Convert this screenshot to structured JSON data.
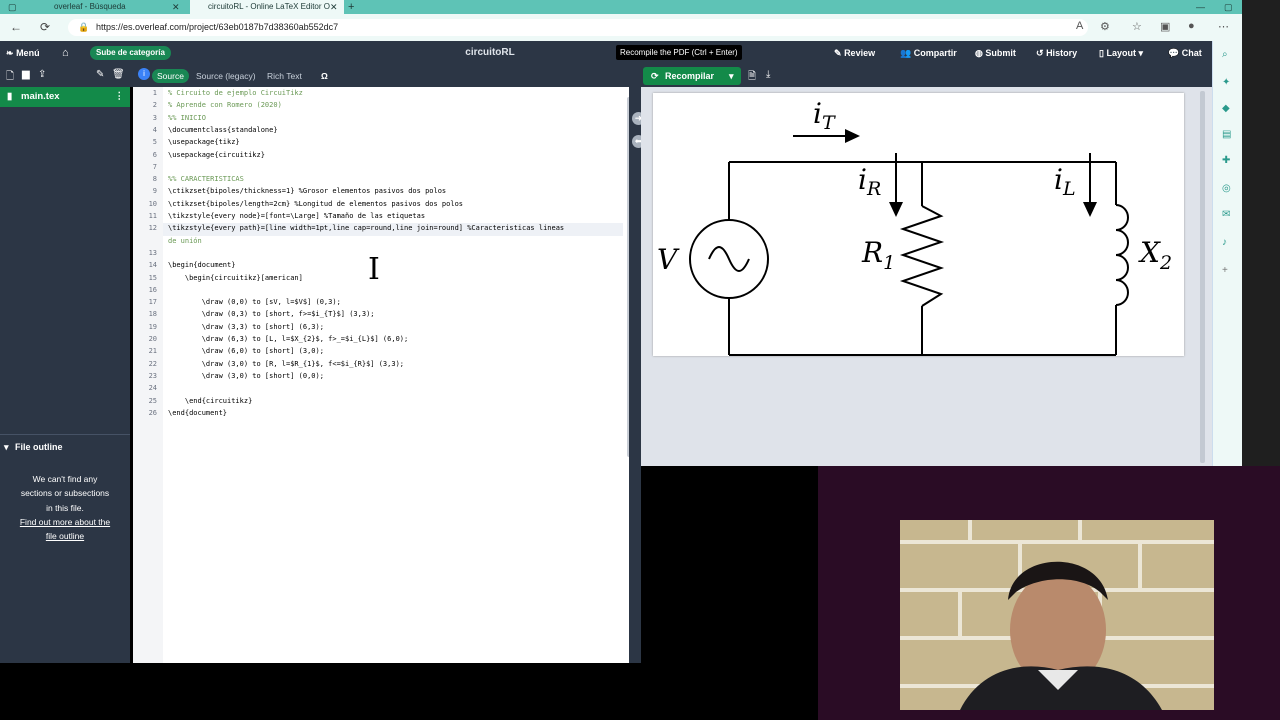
{
  "browser": {
    "tabs": [
      {
        "label": "overleaf - Búsqueda"
      },
      {
        "label": "circuitoRL - Online LaTeX Editor O"
      }
    ],
    "url": "https://es.overleaf.com/project/63eb0187b7d38360ab552dc7"
  },
  "toolbar": {
    "menu": "Menú",
    "category_badge": "Sube de categoría",
    "project_title": "circuitoRL",
    "tooltip": "Recompile the PDF (Ctrl + Enter)",
    "review": "Review",
    "share": "Compartir",
    "submit": "Submit",
    "history": "History",
    "layout": "Layout",
    "chat": "Chat"
  },
  "editor_tabs": {
    "source": "Source",
    "source_legacy": "Source (legacy)",
    "rich_text": "Rich Text",
    "symbol": "Ω"
  },
  "recompile": "Recompilar",
  "file_tree": {
    "main_file": "main.tex"
  },
  "outline": {
    "header": "File outline",
    "line1": "We can't find any",
    "line2": "sections or subsections",
    "line3": "in this file.",
    "link1": "Find out more about the",
    "link2": "file outline"
  },
  "code": [
    {
      "n": "1",
      "text": "% Circuito de ejemplo CircuiTikz",
      "kind": "cmt"
    },
    {
      "n": "2",
      "text": "% Aprende con Romero (2020)",
      "kind": "cmt"
    },
    {
      "n": "3",
      "text": "%% INICIO",
      "kind": "cmt"
    },
    {
      "n": "4",
      "text": "\\documentclass{standalone}",
      "kind": "code"
    },
    {
      "n": "5",
      "text": "\\usepackage{tikz}",
      "kind": "code"
    },
    {
      "n": "6",
      "text": "\\usepackage{circuitikz}",
      "kind": "code"
    },
    {
      "n": "7",
      "text": "",
      "kind": "code"
    },
    {
      "n": "8",
      "text": "%% CARACTERISTICAS",
      "kind": "cmt"
    },
    {
      "n": "9",
      "text": "\\ctikzset{bipoles/thickness=1} %Grosor elementos pasivos dos polos",
      "kind": "code"
    },
    {
      "n": "10",
      "text": "\\ctikzset{bipoles/length=2cm} %Longitud de elementos pasivos dos polos",
      "kind": "code"
    },
    {
      "n": "11",
      "text": "\\tikzstyle{every node}=[font=\\Large] %Tamaño de las etiquetas",
      "kind": "code"
    },
    {
      "n": "12",
      "text": "\\tikzstyle{every path}=[line width=1pt,line cap=round,line join=round] %Caracteristicas lineas",
      "kind": "code"
    },
    {
      "n": "",
      "text": "de unión",
      "kind": "cmt"
    },
    {
      "n": "13",
      "text": "",
      "kind": "code"
    },
    {
      "n": "14",
      "text": "\\begin{document}",
      "kind": "code"
    },
    {
      "n": "15",
      "text": "    \\begin{circuitikz}[american]",
      "kind": "code"
    },
    {
      "n": "16",
      "text": "",
      "kind": "code"
    },
    {
      "n": "17",
      "text": "        \\draw (0,0) to [sV, l=$V$] (0,3);",
      "kind": "code"
    },
    {
      "n": "18",
      "text": "        \\draw (0,3) to [short, f>=$i_{T}$] (3,3);",
      "kind": "code"
    },
    {
      "n": "19",
      "text": "        \\draw (3,3) to [short] (6,3);",
      "kind": "code"
    },
    {
      "n": "20",
      "text": "        \\draw (6,3) to [L, l=$X_{2}$, f>_=$i_{L}$] (6,0);",
      "kind": "code"
    },
    {
      "n": "21",
      "text": "        \\draw (6,0) to [short] (3,0);",
      "kind": "code"
    },
    {
      "n": "22",
      "text": "        \\draw (3,0) to [R, l=$R_{1}$, f<=$i_{R}$] (3,3);",
      "kind": "code"
    },
    {
      "n": "23",
      "text": "        \\draw (3,0) to [short] (0,0);",
      "kind": "code"
    },
    {
      "n": "24",
      "text": "",
      "kind": "code"
    },
    {
      "n": "25",
      "text": "    \\end{circuitikz}",
      "kind": "code"
    },
    {
      "n": "26",
      "text": "\\end{document}",
      "kind": "code"
    }
  ],
  "pdf": {
    "labels": {
      "source": "V",
      "current_total": "i",
      "current_total_sub": "T",
      "current_r": "i",
      "current_r_sub": "R",
      "current_l": "i",
      "current_l_sub": "L",
      "resistor": "R",
      "resistor_sub": "1",
      "inductor": "X",
      "inductor_sub": "2"
    }
  },
  "colors": {
    "overleaf_green": "#138a49",
    "toolbar_bg": "#2c3645",
    "browser_teal": "#5ec3b6"
  }
}
